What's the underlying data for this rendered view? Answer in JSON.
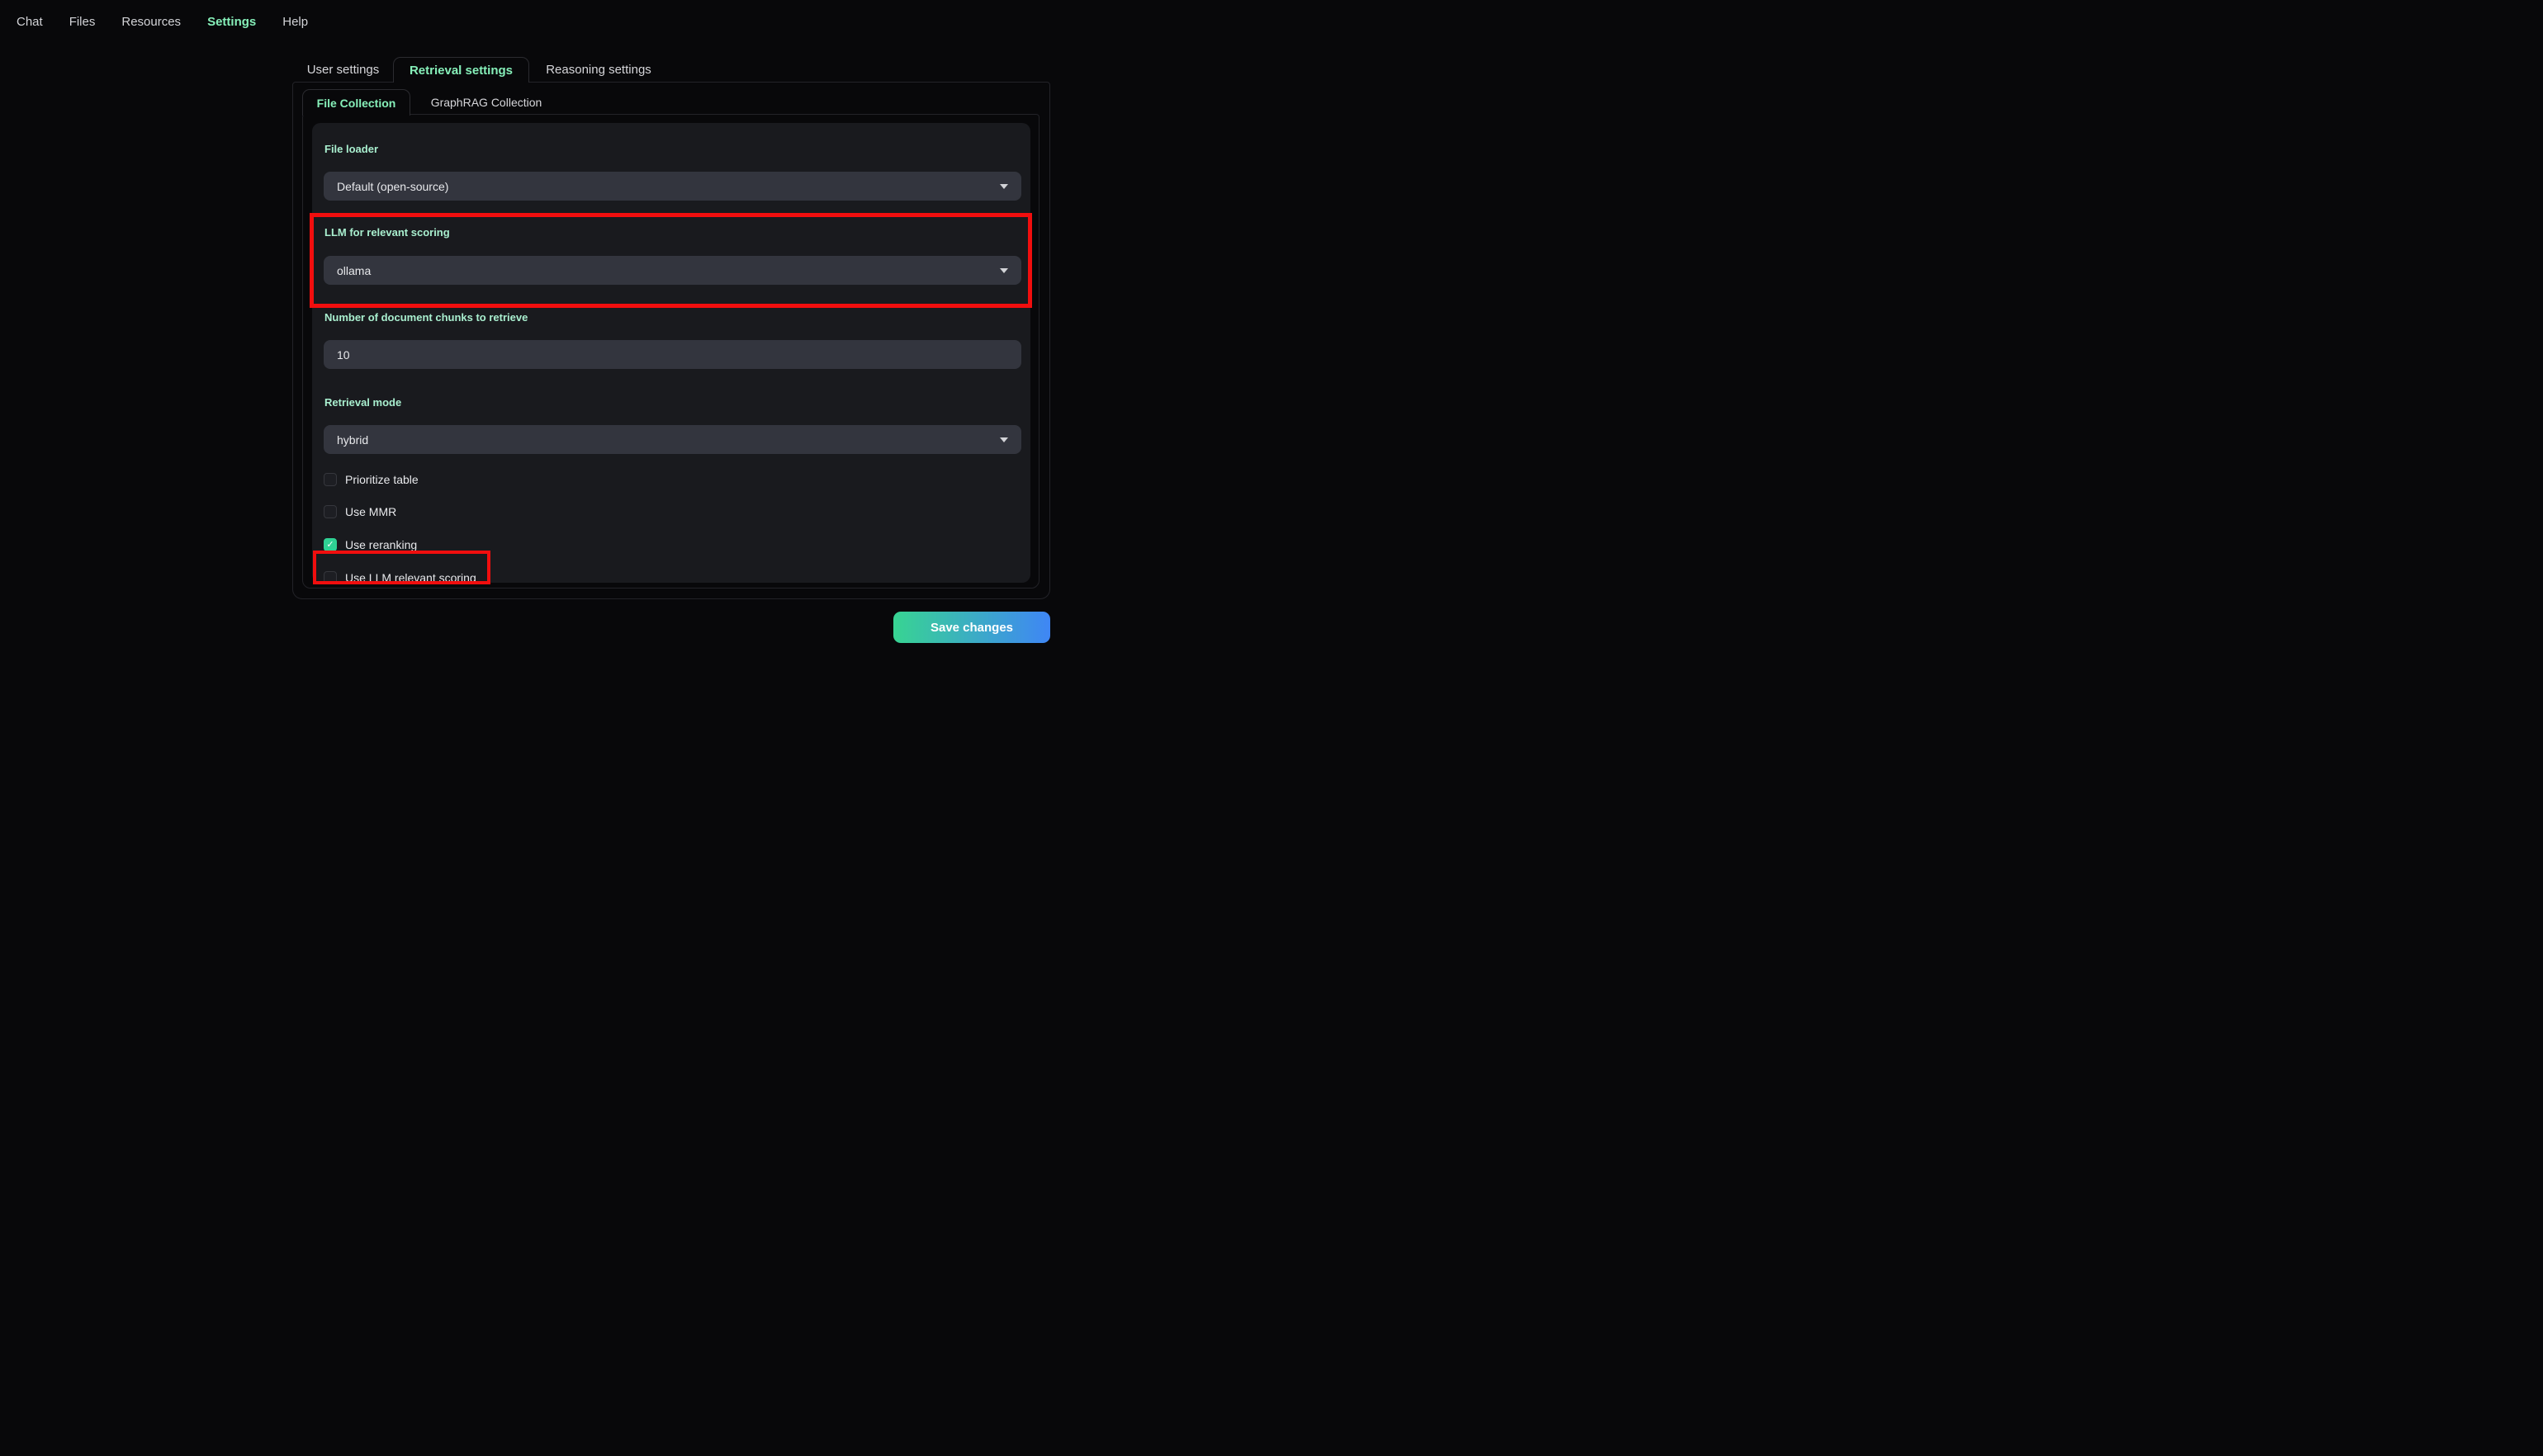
{
  "nav": {
    "items": [
      {
        "label": "Chat",
        "active": false
      },
      {
        "label": "Files",
        "active": false
      },
      {
        "label": "Resources",
        "active": false
      },
      {
        "label": "Settings",
        "active": true
      },
      {
        "label": "Help",
        "active": false
      }
    ]
  },
  "tabs": {
    "items": [
      {
        "label": "User settings",
        "active": false
      },
      {
        "label": "Retrieval settings",
        "active": true
      },
      {
        "label": "Reasoning settings",
        "active": false
      }
    ]
  },
  "subtabs": {
    "items": [
      {
        "label": "File Collection",
        "active": true
      },
      {
        "label": "GraphRAG Collection",
        "active": false
      }
    ]
  },
  "form": {
    "file_loader": {
      "label": "File loader",
      "value": "Default (open-source)"
    },
    "llm_relevant_scoring": {
      "label": "LLM for relevant scoring",
      "value": "ollama"
    },
    "num_chunks": {
      "label": "Number of document chunks to retrieve",
      "value": "10"
    },
    "retrieval_mode": {
      "label": "Retrieval mode",
      "value": "hybrid"
    },
    "checkboxes": [
      {
        "label": "Prioritize table",
        "checked": false
      },
      {
        "label": "Use MMR",
        "checked": false
      },
      {
        "label": "Use reranking",
        "checked": true
      },
      {
        "label": "Use LLM relevant scoring",
        "checked": false
      }
    ]
  },
  "actions": {
    "save_label": "Save changes"
  },
  "icons": {
    "dropdown": "chevron-down-icon",
    "checked": "check-icon",
    "check_glyph": "✓"
  },
  "colors": {
    "accent_mint": "#86efb9",
    "label_mint": "#a9efcf",
    "checkbox_checked": "#2fd194",
    "annotation_red": "#f10e0e",
    "save_gradient_start": "#38d492",
    "save_gradient_end": "#3f86f5",
    "panel_bg": "#191a1e",
    "field_bg": "#33353e"
  }
}
